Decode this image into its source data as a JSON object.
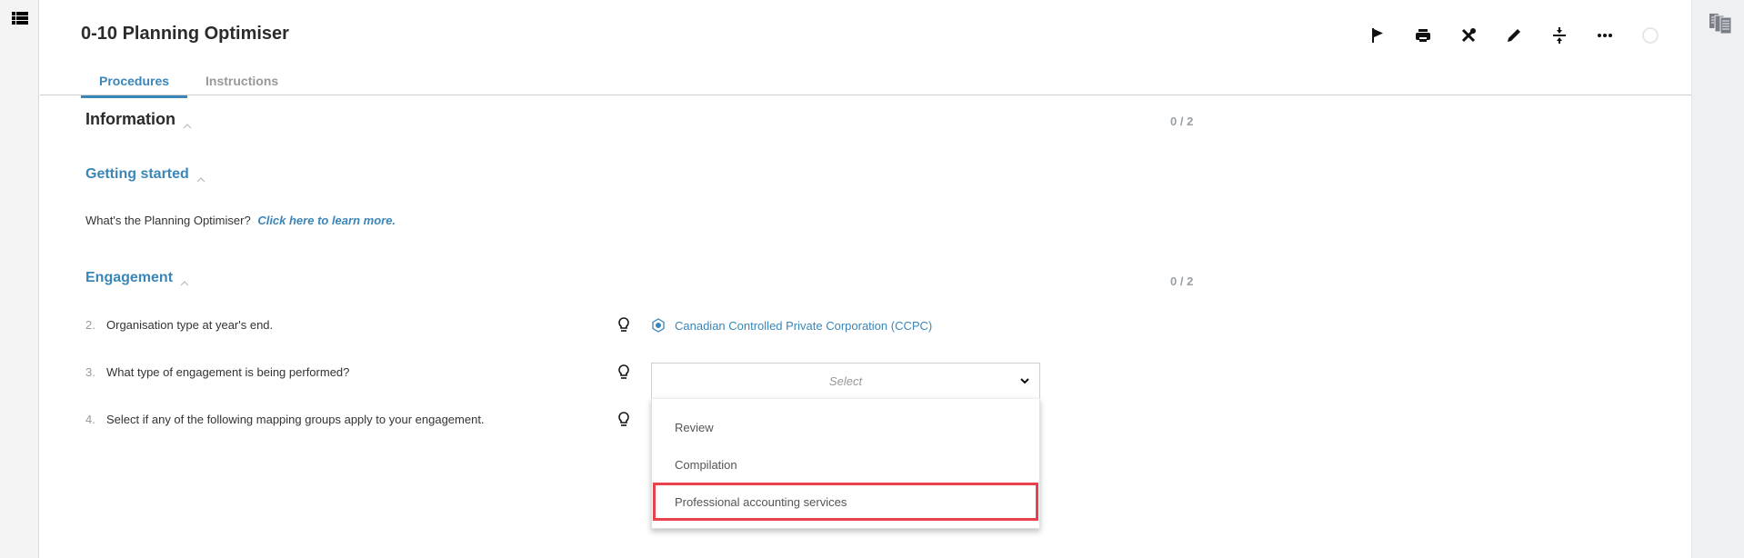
{
  "left_rail": {
    "icon": "list-menu-icon"
  },
  "right_rail": {
    "icon": "documents-icon"
  },
  "header": {
    "title": "0-10 Planning Optimiser",
    "tabs": [
      {
        "label": "Procedures",
        "active": true
      },
      {
        "label": "Instructions",
        "active": false
      }
    ],
    "toolbar": [
      {
        "icon": "flag-icon"
      },
      {
        "icon": "print-icon"
      },
      {
        "icon": "tools-icon"
      },
      {
        "icon": "pencil-icon"
      },
      {
        "icon": "collapse-icon"
      },
      {
        "icon": "more-icon"
      },
      {
        "icon": "status-circle-icon"
      }
    ]
  },
  "sections": {
    "information": {
      "title": "Information",
      "counter": "0 / 2"
    },
    "getting_started": {
      "title": "Getting started",
      "intro_text": "What's the Planning Optimiser?",
      "intro_link": "Click here to learn more."
    },
    "engagement": {
      "title": "Engagement",
      "counter": "0 / 2",
      "questions": [
        {
          "num": "2.",
          "text": "Organisation type at year's end.",
          "answer": "Canadian Controlled Private Corporation (CCPC)"
        },
        {
          "num": "3.",
          "text": "What type of engagement is being performed?",
          "placeholder": "Select"
        },
        {
          "num": "4.",
          "text": "Select if any of the following mapping groups apply to your engagement."
        }
      ]
    }
  },
  "dropdown": {
    "options": [
      "Review",
      "Compilation",
      "Professional accounting services"
    ],
    "highlighted_index": 2
  },
  "colors": {
    "accent": "#3a86b8",
    "highlight_border": "#e8434a",
    "muted": "#999999"
  }
}
